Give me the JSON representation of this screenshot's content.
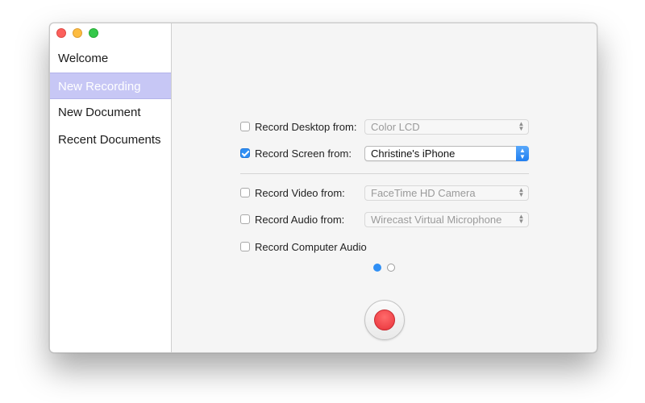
{
  "sidebar": {
    "items": [
      {
        "label": "Welcome"
      },
      {
        "label": "New Recording"
      },
      {
        "label": "New Document"
      },
      {
        "label": "Recent Documents"
      }
    ],
    "active_index": 1
  },
  "recording": {
    "rows": [
      {
        "label": "Record Desktop from:",
        "checked": false,
        "source": "Color LCD"
      },
      {
        "label": "Record Screen from:",
        "checked": true,
        "source": "Christine's iPhone"
      },
      {
        "label": "Record Video from:",
        "checked": false,
        "source": "FaceTime HD Camera"
      },
      {
        "label": "Record Audio from:",
        "checked": false,
        "source": "Wirecast Virtual Microphone"
      },
      {
        "label": "Record Computer Audio",
        "checked": false
      }
    ],
    "pager": {
      "current": 1,
      "total": 2
    }
  },
  "colors": {
    "accent": "#2f8ff5",
    "sidebar_selection": "#c7c7f5",
    "record": "#e8323a"
  },
  "icons": {
    "record": "record-icon",
    "popup_arrows": "chevron-up-down-icon"
  }
}
